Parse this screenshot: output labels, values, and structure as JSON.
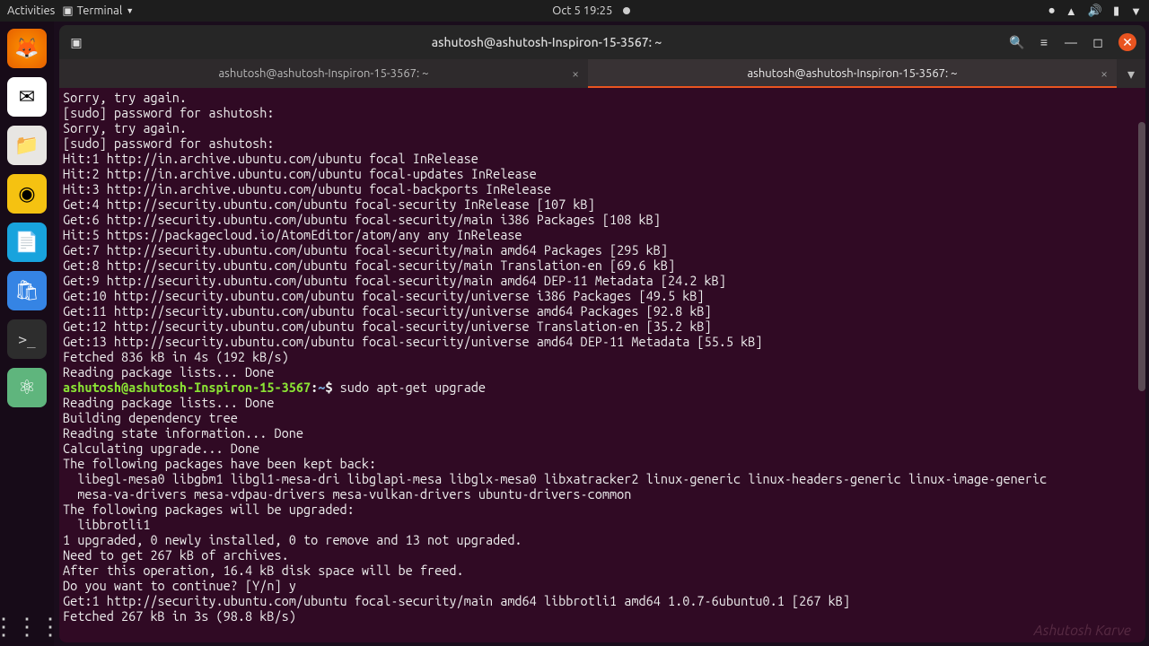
{
  "topbar": {
    "activities": "Activities",
    "app": "Terminal",
    "datetime": "Oct 5  19:25"
  },
  "window": {
    "title": "ashutosh@ashutosh-Inspiron-15-3567: ~"
  },
  "tabs": [
    {
      "label": "ashutosh@ashutosh-Inspiron-15-3567: ~",
      "active": false
    },
    {
      "label": "ashutosh@ashutosh-Inspiron-15-3567: ~",
      "active": true
    }
  ],
  "terminal": {
    "prompt_user": "ashutosh@ashutosh-Inspiron-15-3567",
    "prompt_sep": ":",
    "prompt_path": "~",
    "prompt_end": "$ ",
    "upgrade_cmd": "sudo apt-get upgrade",
    "lines_before": [
      "Sorry, try again.",
      "[sudo] password for ashutosh:",
      "Sorry, try again.",
      "[sudo] password for ashutosh:",
      "Hit:1 http://in.archive.ubuntu.com/ubuntu focal InRelease",
      "Hit:2 http://in.archive.ubuntu.com/ubuntu focal-updates InRelease",
      "Hit:3 http://in.archive.ubuntu.com/ubuntu focal-backports InRelease",
      "Get:4 http://security.ubuntu.com/ubuntu focal-security InRelease [107 kB]",
      "Get:6 http://security.ubuntu.com/ubuntu focal-security/main i386 Packages [108 kB]",
      "Hit:5 https://packagecloud.io/AtomEditor/atom/any any InRelease",
      "Get:7 http://security.ubuntu.com/ubuntu focal-security/main amd64 Packages [295 kB]",
      "Get:8 http://security.ubuntu.com/ubuntu focal-security/main Translation-en [69.6 kB]",
      "Get:9 http://security.ubuntu.com/ubuntu focal-security/main amd64 DEP-11 Metadata [24.2 kB]",
      "Get:10 http://security.ubuntu.com/ubuntu focal-security/universe i386 Packages [49.5 kB]",
      "Get:11 http://security.ubuntu.com/ubuntu focal-security/universe amd64 Packages [92.8 kB]",
      "Get:12 http://security.ubuntu.com/ubuntu focal-security/universe Translation-en [35.2 kB]",
      "Get:13 http://security.ubuntu.com/ubuntu focal-security/universe amd64 DEP-11 Metadata [55.5 kB]",
      "Fetched 836 kB in 4s (192 kB/s)",
      "Reading package lists... Done"
    ],
    "lines_after": [
      "Reading package lists... Done",
      "Building dependency tree",
      "Reading state information... Done",
      "Calculating upgrade... Done",
      "The following packages have been kept back:",
      "  libegl-mesa0 libgbm1 libgl1-mesa-dri libglapi-mesa libglx-mesa0 libxatracker2 linux-generic linux-headers-generic linux-image-generic",
      "  mesa-va-drivers mesa-vdpau-drivers mesa-vulkan-drivers ubuntu-drivers-common",
      "The following packages will be upgraded:",
      "  libbrotli1",
      "1 upgraded, 0 newly installed, 0 to remove and 13 not upgraded.",
      "Need to get 267 kB of archives.",
      "After this operation, 16.4 kB disk space will be freed.",
      "Do you want to continue? [Y/n] y",
      "Get:1 http://security.ubuntu.com/ubuntu focal-security/main amd64 libbrotli1 amd64 1.0.7-6ubuntu0.1 [267 kB]",
      "Fetched 267 kB in 3s (98.8 kB/s)"
    ]
  },
  "watermark": "Ashutosh Karve"
}
